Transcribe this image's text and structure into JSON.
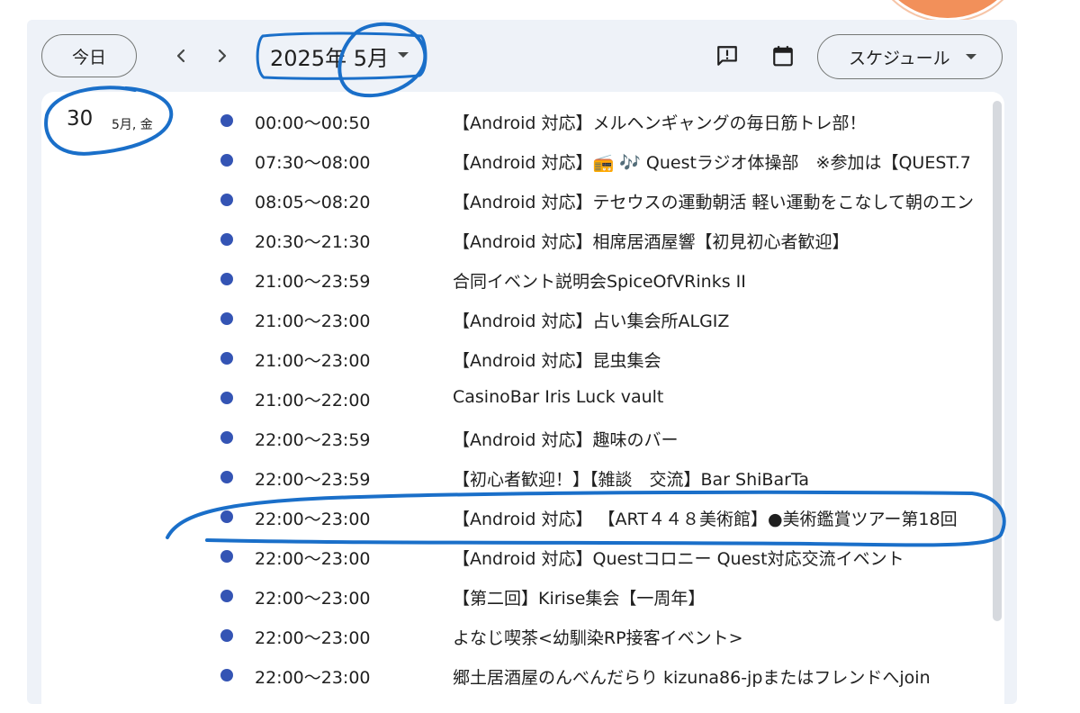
{
  "header": {
    "today_label": "今日",
    "prev_icon": "chevron-left-icon",
    "next_icon": "chevron-right-icon",
    "month_label": "2025年 5月",
    "feedback_icon": "feedback-icon",
    "calendar_icon": "calendar-icon",
    "view_label": "スケジュール"
  },
  "date": {
    "day": "30",
    "sub": "5月, 金"
  },
  "colors": {
    "event_dot": "#3454b4",
    "annotation_ink": "#1a6fc9",
    "panel_bg": "#eef2f8"
  },
  "events": [
    {
      "time": "00:00〜00:50",
      "title": "【Android 対応】メルヘンギャングの毎日筋トレ部！"
    },
    {
      "time": "07:30〜08:00",
      "title": "【Android 対応】📻 🎶 Questラジオ体操部　※参加は【QUEST.7"
    },
    {
      "time": "08:05〜08:20",
      "title": "【Android 対応】テセウスの運動朝活 軽い運動をこなして朝のエン"
    },
    {
      "time": "20:30〜21:30",
      "title": "【Android 対応】相席居酒屋響【初見初心者歓迎】"
    },
    {
      "time": "21:00〜23:59",
      "title": "合同イベント説明会SpiceOfVRinks II"
    },
    {
      "time": "21:00〜23:00",
      "title": "【Android 対応】占い集会所ALGIZ"
    },
    {
      "time": "21:00〜23:00",
      "title": "【Android 対応】昆虫集会"
    },
    {
      "time": "21:00〜22:00",
      "title": "CasinoBar Iris Luck vault"
    },
    {
      "time": "22:00〜23:59",
      "title": "【Android 対応】趣味のバー"
    },
    {
      "time": "22:00〜23:59",
      "title": "【初心者歓迎！】【雑談　交流】Bar ShiBarTa"
    },
    {
      "time": "22:00〜23:00",
      "title": "【Android 対応】 【ART４４８美術館】●美術鑑賞ツアー第18回"
    },
    {
      "time": "22:00〜23:00",
      "title": "【Android 対応】Questコロニー Quest対応交流イベント"
    },
    {
      "time": "22:00〜23:00",
      "title": "【第二回】Kirise集会【一周年】"
    },
    {
      "time": "22:00〜23:00",
      "title": "よなじ喫茶<幼馴染RP接客イベント>"
    },
    {
      "time": "22:00〜23:00",
      "title": "郷土居酒屋のんべんだらり kizuna86-jpまたはフレンドへjoin"
    }
  ]
}
